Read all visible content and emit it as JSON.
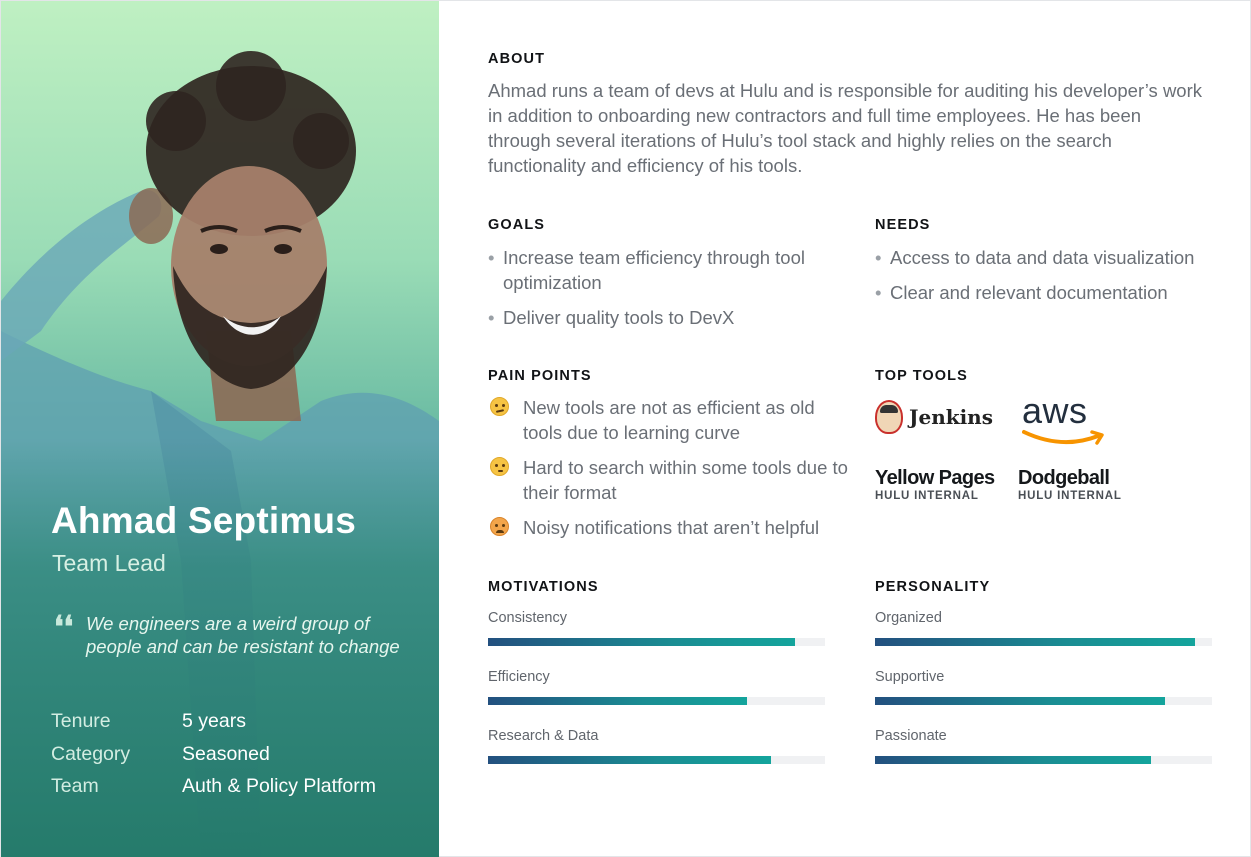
{
  "profile": {
    "name": "Ahmad Septimus",
    "role": "Team Lead",
    "quote_mark": "❛❛",
    "quote": "We engineers are a weird group of people and can be resistant to change",
    "info": [
      {
        "label": "Tenure",
        "value": "5 years"
      },
      {
        "label": "Category",
        "value": "Seasoned"
      },
      {
        "label": "Team",
        "value": "Auth & Policy Platform"
      }
    ]
  },
  "about": {
    "title": "ABOUT",
    "text": "Ahmad runs a team of devs at Hulu and is responsible for auditing his developer’s work in addition to onboarding new contractors and full time employees. He has been through several iterations of Hulu’s tool stack and highly relies on the search functionality and efficiency of his tools."
  },
  "goals": {
    "title": "GOALS",
    "items": [
      "Increase team efficiency through tool optimization",
      "Deliver quality tools to DevX"
    ]
  },
  "needs": {
    "title": "NEEDS",
    "items": [
      "Access to data and data visualization",
      "Clear and relevant documentation"
    ]
  },
  "pain_points": {
    "title": "PAIN POINTS",
    "items": [
      {
        "text": "New tools are not as efficient as old tools due to learning curve",
        "icon": "confused-face-icon"
      },
      {
        "text": "Hard to search within some tools due to their format",
        "icon": "thinking-face-icon"
      },
      {
        "text": "Noisy notifications that aren’t helpful",
        "icon": "angry-face-icon"
      }
    ]
  },
  "top_tools": {
    "title": "TOP TOOLS",
    "jenkins": "Jenkins",
    "aws": "aws",
    "yellow_pages": {
      "name": "Yellow Pages",
      "sub": "HULU INTERNAL"
    },
    "dodgeball": {
      "name": "Dodgeball",
      "sub": "HULU INTERNAL"
    }
  },
  "motivations": {
    "title": "MOTIVATIONS",
    "items": [
      {
        "label": "Consistency",
        "value": 0.91
      },
      {
        "label": "Efficiency",
        "value": 0.77
      },
      {
        "label": "Research & Data",
        "value": 0.84
      }
    ]
  },
  "personality": {
    "title": "PERSONALITY",
    "items": [
      {
        "label": "Organized",
        "value": 0.95
      },
      {
        "label": "Supportive",
        "value": 0.86
      },
      {
        "label": "Passionate",
        "value": 0.82
      }
    ]
  },
  "colors": {
    "panel_top": "#bff0c2",
    "panel_bottom": "#1f7d66",
    "bar_start": "#23507f",
    "bar_end": "#14a49c",
    "aws_orange": "#f79400"
  }
}
